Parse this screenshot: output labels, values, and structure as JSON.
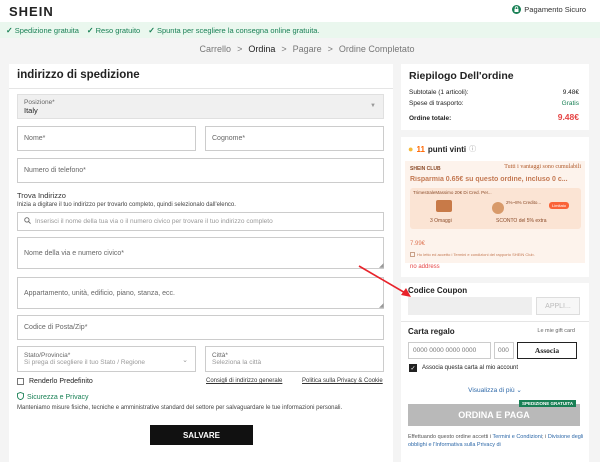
{
  "header": {
    "logo": "SHEIN",
    "secure_label": "Pagamento Sicuro"
  },
  "promo": [
    "Spedizione gratuita",
    "Reso gratuito",
    "Spunta per scegliere la consegna online gratuita."
  ],
  "steps": {
    "s1": "Carrello",
    "s2": "Ordina",
    "s3": "Pagare",
    "s4": "Ordine Completato",
    "sep": ">"
  },
  "address": {
    "title": "indirizzo di spedizione",
    "country_label": "Posizione*",
    "country_value": "Italy",
    "first_name": "Nome*",
    "last_name": "Cognome*",
    "phone": "Numero di telefono*",
    "find_title": "Trova Indirizzo",
    "find_hint": "Inizia a digitare il tuo indirizzo per trovarlo completo, quindi selezionalo dall'elenco.",
    "find_placeholder": "Inserisci il nome della tua via o il numero civico per trovare il tuo indirizzo completo",
    "street": "Nome della via e numero civico*",
    "apartment": "Appartamento, unità, edificio, piano, stanza, ecc.",
    "zip": "Codice di Posta/Zip*",
    "state_label": "Stato/Provincia*",
    "state_placeholder": "Si prega di scegliere il tuo Stato / Regione",
    "city_label": "Città*",
    "city_placeholder": "Seleziona la città",
    "default_label": "Renderlo Predefinito",
    "tips_link": "Consigli di indirizzo generale",
    "privacy_link": "Politica sulla Privacy & Cookie",
    "security_title": "Sicurezza e Privacy",
    "security_text": "Manteniamo misure fisiche, tecniche e amministrative standard del settore per salvaguardare le tue informazioni personali.",
    "save": "SALVARE"
  },
  "summary": {
    "title": "Riepilogo Dell'ordine",
    "subtotal_label": "Subtotale (1 articoli):",
    "subtotal_value": "9.48€",
    "shipping_label": "Spese di trasporto:",
    "shipping_value": "Gratis",
    "total_label": "Ordine totale:",
    "total_value": "9.48€"
  },
  "points": {
    "count": "11",
    "label": "punti vinti",
    "club_name": "SHEIN CLUB",
    "club_slogan": "Tutti i vantaggi sono cumulabili",
    "save_text": "Risparmia 0.65€ su questo ordine, incluso 0 c...",
    "trimestrale": "TrimestraleMassimo 20€ Di Cred. Per...",
    "gifts": "3 Omaggi",
    "percent": "2%~8% Credito...",
    "badge": "Limitato",
    "discount": "SCONTO del 5% extra",
    "price": "7.99€",
    "terms": "Ho letto ed accetto i Termini e condizioni del rapporto SHEIN Club.",
    "no_address": "no address"
  },
  "coupon": {
    "title": "Codice Coupon",
    "apply": "APPLI..."
  },
  "gift": {
    "title": "Carta regalo",
    "my_gift": "Le mie gift card",
    "number_placeholder": "0000 0000 0000 0000",
    "pin_placeholder": "000",
    "assign": "Associa",
    "assign_account": "Associa questa carta al mio account",
    "more": "Visualizza di più"
  },
  "pay": {
    "badge": "SPEDIZIONE GRATUITA",
    "button": "ORDINA E PAGA",
    "legal_prefix": "Effettuando questo ordine accetti i ",
    "legal_link1": "Termini e Condizioni",
    "legal_mid": "; i ",
    "legal_link2": "Divisione degli obblighi e l'Informativa sulla Privacy di",
    "legal_suffix": "..."
  },
  "colors": {
    "green": "#198055",
    "red": "#fa6338",
    "orange": "#f60",
    "accent_red": "#e64545"
  }
}
